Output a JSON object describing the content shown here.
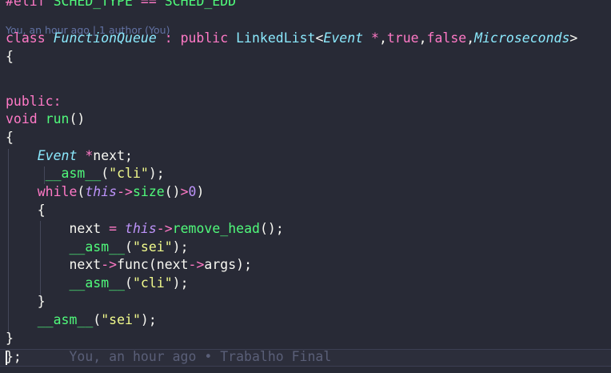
{
  "editor": {
    "colors": {
      "background": "#282a36",
      "keyword": "#ff79c6",
      "function": "#50fa7b",
      "class": "#8be9fd",
      "string": "#f1fa8c",
      "number": "#bd93f9",
      "comment": "#6272a4"
    },
    "codelens": "You, an hour ago | 1 author (You)",
    "inline_blame": "You, an hour ago • Trabalho Final",
    "lines": [
      [
        {
          "t": "#elif",
          "c": "pre"
        },
        {
          "t": " ",
          "c": "plain"
        },
        {
          "t": "SCHED_TYPE",
          "c": "macro"
        },
        {
          "t": " ",
          "c": "plain"
        },
        {
          "t": "==",
          "c": "op"
        },
        {
          "t": " ",
          "c": "plain"
        },
        {
          "t": "SCHED_EDD",
          "c": "macro"
        }
      ],
      [
        {
          "t": "class",
          "c": "kw"
        },
        {
          "t": " ",
          "c": "plain"
        },
        {
          "t": "FunctionQueue",
          "c": "cls"
        },
        {
          "t": " ",
          "c": "plain"
        },
        {
          "t": ":",
          "c": "op"
        },
        {
          "t": " ",
          "c": "plain"
        },
        {
          "t": "public",
          "c": "kw"
        },
        {
          "t": " ",
          "c": "plain"
        },
        {
          "t": "LinkedList",
          "c": "type"
        },
        {
          "t": "<",
          "c": "plain"
        },
        {
          "t": "Event",
          "c": "cls"
        },
        {
          "t": " ",
          "c": "plain"
        },
        {
          "t": "*",
          "c": "op"
        },
        {
          "t": ",",
          "c": "plain"
        },
        {
          "t": "true",
          "c": "kw"
        },
        {
          "t": ",",
          "c": "plain"
        },
        {
          "t": "false",
          "c": "kw"
        },
        {
          "t": ",",
          "c": "plain"
        },
        {
          "t": "Microseconds",
          "c": "cls"
        },
        {
          "t": ">",
          "c": "plain"
        }
      ],
      [
        {
          "t": "{",
          "c": "plain"
        }
      ],
      [],
      [
        {
          "t": "public:",
          "c": "kw"
        }
      ],
      [
        {
          "t": "void",
          "c": "kw"
        },
        {
          "t": " ",
          "c": "plain"
        },
        {
          "t": "run",
          "c": "fn"
        },
        {
          "t": "()",
          "c": "plain"
        }
      ],
      [
        {
          "t": "{",
          "c": "plain"
        }
      ],
      [
        {
          "t": "    ",
          "c": "plain"
        },
        {
          "t": "Event",
          "c": "cls"
        },
        {
          "t": " ",
          "c": "plain"
        },
        {
          "t": "*",
          "c": "op"
        },
        {
          "t": "next;",
          "c": "plain"
        }
      ],
      [
        {
          "t": "     ",
          "c": "plain"
        },
        {
          "t": "__asm__",
          "c": "fn"
        },
        {
          "t": "(",
          "c": "plain"
        },
        {
          "t": "\"cli\"",
          "c": "str"
        },
        {
          "t": ");",
          "c": "plain"
        }
      ],
      [
        {
          "t": "    ",
          "c": "plain"
        },
        {
          "t": "while",
          "c": "kw"
        },
        {
          "t": "(",
          "c": "plain"
        },
        {
          "t": "this",
          "c": "this"
        },
        {
          "t": "->",
          "c": "op"
        },
        {
          "t": "size",
          "c": "fn"
        },
        {
          "t": "()",
          "c": "plain"
        },
        {
          "t": ">",
          "c": "op"
        },
        {
          "t": "0",
          "c": "num"
        },
        {
          "t": ")",
          "c": "plain"
        }
      ],
      [
        {
          "t": "    ",
          "c": "plain"
        },
        {
          "t": "{",
          "c": "plain"
        }
      ],
      [
        {
          "t": "        ",
          "c": "plain"
        },
        {
          "t": "next",
          "c": "plain"
        },
        {
          "t": " ",
          "c": "plain"
        },
        {
          "t": "=",
          "c": "op"
        },
        {
          "t": " ",
          "c": "plain"
        },
        {
          "t": "this",
          "c": "this"
        },
        {
          "t": "->",
          "c": "op"
        },
        {
          "t": "remove_head",
          "c": "fn"
        },
        {
          "t": "();",
          "c": "plain"
        }
      ],
      [
        {
          "t": "        ",
          "c": "plain"
        },
        {
          "t": "__asm__",
          "c": "fn"
        },
        {
          "t": "(",
          "c": "plain"
        },
        {
          "t": "\"sei\"",
          "c": "str"
        },
        {
          "t": ");",
          "c": "plain"
        }
      ],
      [
        {
          "t": "        ",
          "c": "plain"
        },
        {
          "t": "next",
          "c": "plain"
        },
        {
          "t": "->",
          "c": "op"
        },
        {
          "t": "func",
          "c": "plain"
        },
        {
          "t": "(",
          "c": "plain"
        },
        {
          "t": "next",
          "c": "plain"
        },
        {
          "t": "->",
          "c": "op"
        },
        {
          "t": "args",
          "c": "plain"
        },
        {
          "t": ");",
          "c": "plain"
        }
      ],
      [
        {
          "t": "        ",
          "c": "plain"
        },
        {
          "t": "__asm__",
          "c": "fn"
        },
        {
          "t": "(",
          "c": "plain"
        },
        {
          "t": "\"cli\"",
          "c": "str"
        },
        {
          "t": ");",
          "c": "plain"
        }
      ],
      [
        {
          "t": "    ",
          "c": "plain"
        },
        {
          "t": "}",
          "c": "plain"
        }
      ],
      [
        {
          "t": "    ",
          "c": "plain"
        },
        {
          "t": "__asm__",
          "c": "fn"
        },
        {
          "t": "(",
          "c": "plain"
        },
        {
          "t": "\"sei\"",
          "c": "str"
        },
        {
          "t": ");",
          "c": "plain"
        }
      ],
      [
        {
          "t": "}",
          "c": "plain"
        }
      ],
      [
        {
          "t": "};",
          "c": "plain"
        }
      ]
    ]
  }
}
